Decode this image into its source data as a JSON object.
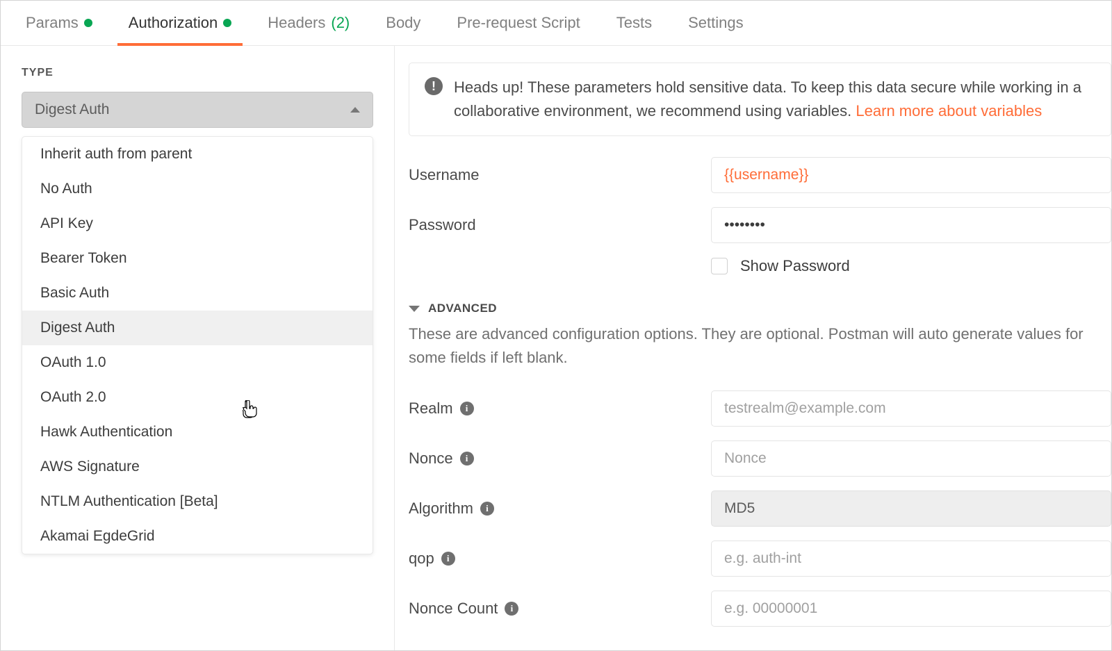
{
  "tabs": {
    "params": "Params",
    "authorization": "Authorization",
    "headers": "Headers",
    "headers_count": "(2)",
    "body": "Body",
    "pre_request": "Pre-request Script",
    "tests": "Tests",
    "settings": "Settings"
  },
  "left": {
    "type_label": "TYPE",
    "selected": "Digest Auth",
    "options": [
      "Inherit auth from parent",
      "No Auth",
      "API Key",
      "Bearer Token",
      "Basic Auth",
      "Digest Auth",
      "OAuth 1.0",
      "OAuth 2.0",
      "Hawk Authentication",
      "AWS Signature",
      "NTLM Authentication [Beta]",
      "Akamai EgdeGrid"
    ]
  },
  "notice": {
    "text": "Heads up! These parameters hold sensitive data. To keep this data secure while working in a collaborative environment, we recommend using variables. ",
    "link": "Learn more about variables"
  },
  "fields": {
    "username_label": "Username",
    "username_value": "{{username}}",
    "password_label": "Password",
    "password_value": "••••••••",
    "show_password": "Show Password",
    "advanced_heading": "ADVANCED",
    "advanced_desc": "These are advanced configuration options. They are optional. Postman will auto generate values for some fields if left blank.",
    "realm_label": "Realm",
    "realm_placeholder": "testrealm@example.com",
    "nonce_label": "Nonce",
    "nonce_placeholder": "Nonce",
    "algorithm_label": "Algorithm",
    "algorithm_value": "MD5",
    "qop_label": "qop",
    "qop_placeholder": "e.g. auth-int",
    "nonce_count_label": "Nonce Count",
    "nonce_count_placeholder": "e.g. 00000001"
  }
}
